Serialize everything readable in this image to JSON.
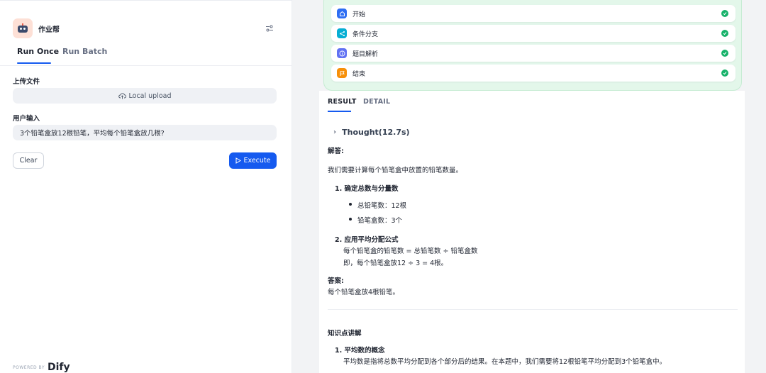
{
  "app": {
    "name": "作业帮"
  },
  "tabs": {
    "run_once": "Run Once",
    "run_batch": "Run Batch"
  },
  "form": {
    "upload_label": "上传文件",
    "upload_button": "Local upload",
    "input_label": "用户输入",
    "input_value": "3个铅笔盒放12根铅笔，平均每个铅笔盒放几根?"
  },
  "actions": {
    "clear": "Clear",
    "execute": "Execute"
  },
  "footer": {
    "powered": "POWERED BY",
    "brand": "Dify"
  },
  "workflow": {
    "nodes": [
      {
        "label": "开始",
        "icon": "home-icon",
        "color": "#2e6ef3",
        "status": "success"
      },
      {
        "label": "条件分支",
        "icon": "branch-icon",
        "color": "#06aed4",
        "status": "success"
      },
      {
        "label": "题目解析",
        "icon": "info-icon",
        "color": "#6172f3",
        "status": "success"
      },
      {
        "label": "结束",
        "icon": "flag-icon",
        "color": "#f79009",
        "status": "success"
      }
    ]
  },
  "result_tabs": {
    "result": "RESULT",
    "detail": "DETAIL"
  },
  "result": {
    "thought": "Thought(12.7s)",
    "answer_heading": "解答:",
    "intro": "我们需要计算每个铅笔盒中放置的铅笔数量。",
    "step1_title": "1. 确定总数与分量数",
    "step1_b1": "总铅笔数：12根",
    "step1_b2": "铅笔盒数：3个",
    "step2_title": "2. 应用平均分配公式",
    "step2_l1": "每个铅笔盒的铅笔数 = 总铅笔数 ÷ 铅笔盒数",
    "step2_l2": "即，每个铅笔盒放12 ÷ 3 = 4根。",
    "answer_label": "答案:",
    "answer_text": "每个铅笔盒放4根铅笔。",
    "knowledge_heading": "知识点讲解",
    "k1_title": "1. 平均数的概念",
    "k1_text": "平均数是指将总数平均分配到各个部分后的结果。在本题中，我们需要将12根铅笔平均分配到3个铅笔盒中。"
  },
  "colors": {
    "accent": "#155aef",
    "success": "#17b26a",
    "workflow_bg": "#e3f7ea"
  }
}
